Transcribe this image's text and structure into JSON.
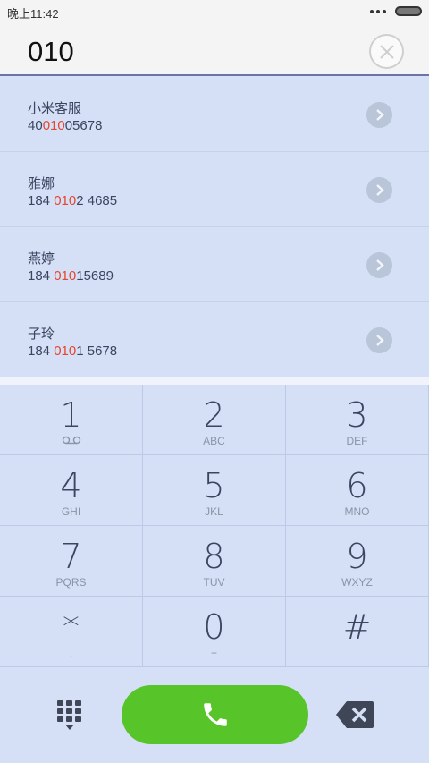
{
  "status": {
    "time": "晚上11:42"
  },
  "dialer": {
    "dialed_number": "010"
  },
  "contacts": [
    {
      "name": "小米客服",
      "number_pre": "40",
      "number_match": "010",
      "number_post": "05678"
    },
    {
      "name": "雅娜",
      "number_pre": "184 ",
      "number_match": "010",
      "number_post": "2 4685"
    },
    {
      "name": "燕婷",
      "number_pre": "184 ",
      "number_match": "010",
      "number_post": "15689"
    },
    {
      "name": "子玲",
      "number_pre": "184 ",
      "number_match": "010",
      "number_post": "1 5678"
    }
  ],
  "keypad": [
    {
      "digit": "1",
      "letters": ""
    },
    {
      "digit": "2",
      "letters": "ABC"
    },
    {
      "digit": "3",
      "letters": "DEF"
    },
    {
      "digit": "4",
      "letters": "GHI"
    },
    {
      "digit": "5",
      "letters": "JKL"
    },
    {
      "digit": "6",
      "letters": "MNO"
    },
    {
      "digit": "7",
      "letters": "PQRS"
    },
    {
      "digit": "8",
      "letters": "TUV"
    },
    {
      "digit": "9",
      "letters": "WXYZ"
    },
    {
      "digit": "*",
      "letters": ","
    },
    {
      "digit": "0",
      "letters": "+"
    },
    {
      "digit": "#",
      "letters": ""
    }
  ],
  "colors": {
    "accent_match": "#e5462e",
    "call_green": "#57c42a",
    "background": "#d5dff5"
  },
  "icons": {
    "clear": "close-icon",
    "detail": "chevron-right-icon",
    "voicemail": "voicemail-icon",
    "dialpad": "dialpad-icon",
    "call": "phone-icon",
    "backspace": "backspace-icon"
  }
}
